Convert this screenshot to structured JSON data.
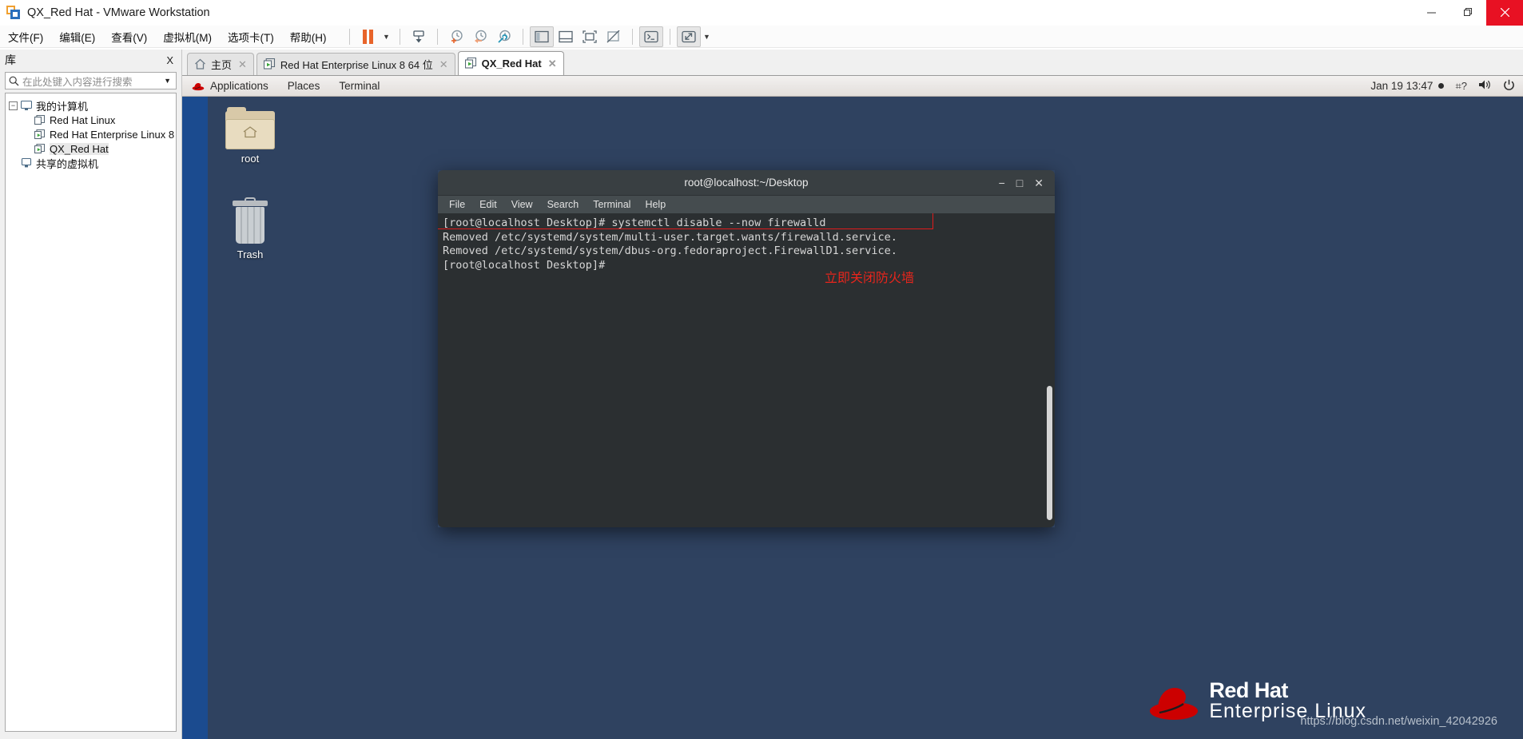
{
  "window": {
    "title": "QX_Red Hat - VMware Workstation",
    "minimize": "minimize-icon",
    "restore": "restore-icon",
    "close": "close-icon"
  },
  "menubar": {
    "items": [
      {
        "label": "文件(F)",
        "name": "menu-file"
      },
      {
        "label": "编辑(E)",
        "name": "menu-edit"
      },
      {
        "label": "查看(V)",
        "name": "menu-view"
      },
      {
        "label": "虚拟机(M)",
        "name": "menu-vm"
      },
      {
        "label": "选项卡(T)",
        "name": "menu-tabs"
      },
      {
        "label": "帮助(H)",
        "name": "menu-help"
      }
    ]
  },
  "toolbar": {
    "buttons": [
      {
        "name": "suspend-button",
        "icon": "pause-icon"
      },
      {
        "name": "power-dropdown",
        "icon": "chevron-down-icon"
      },
      {
        "name": "send-ctrl-alt-del-button",
        "icon": "keyboard-send-icon"
      },
      {
        "name": "take-snapshot-button",
        "icon": "snapshot-add-icon"
      },
      {
        "name": "revert-snapshot-button",
        "icon": "snapshot-revert-icon"
      },
      {
        "name": "snapshot-manager-button",
        "icon": "snapshot-manager-icon"
      },
      {
        "name": "show-library-button",
        "icon": "panel-left-icon"
      },
      {
        "name": "show-thumbnails-button",
        "icon": "panel-bottom-icon"
      },
      {
        "name": "show-console-view-button",
        "icon": "fullscreen-box-icon"
      },
      {
        "name": "hide-console-view-button",
        "icon": "box-crossed-icon"
      },
      {
        "name": "unity-mode-button",
        "icon": "terminal-prompt-icon"
      },
      {
        "name": "fullscreen-button",
        "icon": "expand-arrows-icon"
      },
      {
        "name": "fullscreen-dropdown",
        "icon": "chevron-down-icon"
      }
    ]
  },
  "library": {
    "title": "库",
    "close_label": "X",
    "search_placeholder": "在此处键入内容进行搜索",
    "search_value": "",
    "tree": [
      {
        "label": "我的计算机",
        "level": 1,
        "icon": "computer-icon",
        "expander": "−",
        "selected": false
      },
      {
        "label": "Red Hat Linux",
        "level": 2,
        "icon": "vm-stopped-icon",
        "selected": false
      },
      {
        "label": "Red Hat Enterprise Linux 8",
        "level": 2,
        "icon": "vm-running-icon",
        "selected": false
      },
      {
        "label": "QX_Red Hat",
        "level": 2,
        "icon": "vm-running-icon",
        "selected": true
      },
      {
        "label": "共享的虚拟机",
        "level": 1.5,
        "icon": "shared-vm-icon",
        "selected": false
      }
    ]
  },
  "tabs": [
    {
      "label": "主页",
      "icon": "home-icon",
      "active": false,
      "closable": true
    },
    {
      "label": "Red Hat Enterprise Linux 8 64 位",
      "icon": "vm-running-icon",
      "active": false,
      "closable": true
    },
    {
      "label": "QX_Red Hat",
      "icon": "vm-running-icon",
      "active": true,
      "closable": true
    }
  ],
  "gnome": {
    "menus": [
      "Applications",
      "Places",
      "Terminal"
    ],
    "brand_icon": "red-hat-fedora-icon",
    "clock": "Jan 19  13:47",
    "indicators": [
      "input-method-icon",
      "volume-icon",
      "power-icon"
    ]
  },
  "desktop": {
    "icons": [
      {
        "label": "root",
        "icon": "home-folder-icon"
      },
      {
        "label": "Trash",
        "icon": "trash-icon"
      }
    ],
    "branding": {
      "line1": "Red Hat",
      "line2": "Enterprise Linux",
      "hat_icon": "red-hat-logo-icon"
    },
    "watermark": "https://blog.csdn.net/weixin_42042926"
  },
  "terminal": {
    "title": "root@localhost:~/Desktop",
    "window_buttons": {
      "minimize": "−",
      "maximize": "□",
      "close": "✕"
    },
    "menu": [
      "File",
      "Edit",
      "View",
      "Search",
      "Terminal",
      "Help"
    ],
    "lines": [
      "[root@localhost Desktop]# systemctl disable --now firewalld",
      "Removed /etc/systemd/system/multi-user.target.wants/firewalld.service.",
      "Removed /etc/systemd/system/dbus-org.fedoraproject.FirewallD1.service.",
      "[root@localhost Desktop]#"
    ]
  },
  "annotation": {
    "text": "立即关闭防火墙",
    "color": "#e8251c",
    "highlight_box_color": "#e01b1b"
  }
}
